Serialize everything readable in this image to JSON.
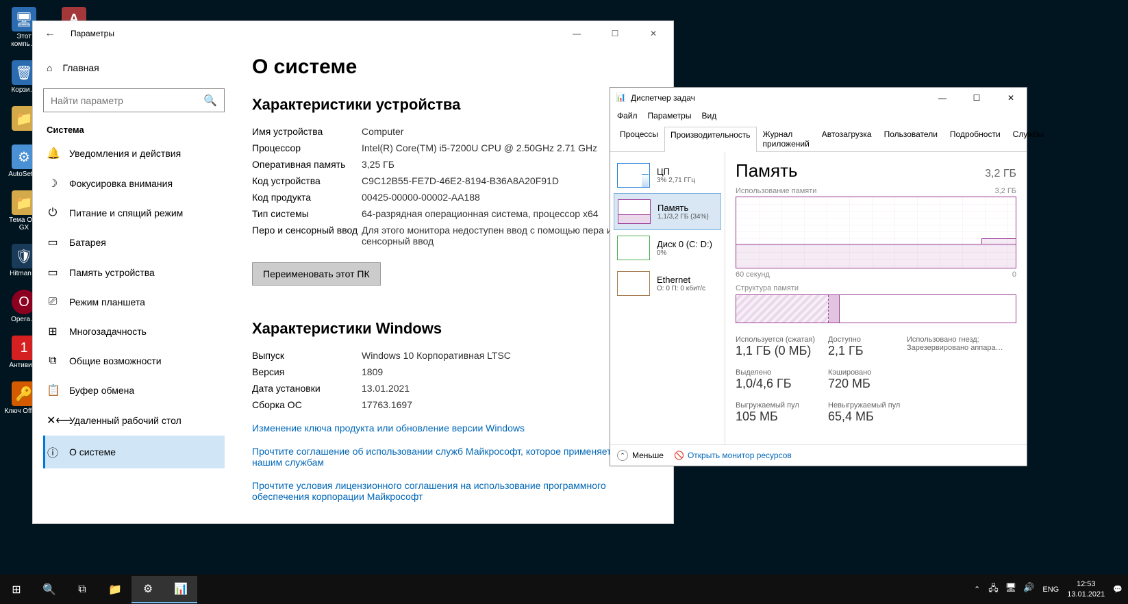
{
  "desktop": {
    "icons": [
      {
        "label": "Этот компь…",
        "color": "#2b6cb0"
      },
      {
        "label": "Корзи…",
        "color": "#2b6cb0"
      },
      {
        "label": "",
        "color": "#d4a94a"
      },
      {
        "label": "AutoSet…",
        "color": "#4a90d4"
      },
      {
        "label": "Тема О… GX",
        "color": "#d4a94a"
      },
      {
        "label": "Hitman…",
        "color": "#4a90d4"
      },
      {
        "label": "Opera…",
        "color": "#8b0020"
      },
      {
        "label": "Антиви…",
        "color": "#d42020"
      },
      {
        "label": "Ключ Offic…",
        "color": "#d45a00"
      }
    ],
    "access_icon": "Access"
  },
  "settings": {
    "title": "Параметры",
    "home": "Главная",
    "search_placeholder": "Найти параметр",
    "section": "Система",
    "nav": [
      {
        "icon": "🔔",
        "label": "Уведомления и действия"
      },
      {
        "icon": "☽",
        "label": "Фокусировка внимания"
      },
      {
        "icon": "⏻",
        "label": "Питание и спящий режим"
      },
      {
        "icon": "▭",
        "label": "Батарея"
      },
      {
        "icon": "▭",
        "label": "Память устройства"
      },
      {
        "icon": "⎚",
        "label": "Режим планшета"
      },
      {
        "icon": "⊞",
        "label": "Многозадачность"
      },
      {
        "icon": "⧉",
        "label": "Общие возможности"
      },
      {
        "icon": "📋",
        "label": "Буфер обмена"
      },
      {
        "icon": "✕⟵",
        "label": "Удаленный рабочий стол"
      },
      {
        "icon": "ⓘ",
        "label": "О системе"
      }
    ],
    "content": {
      "heading": "О системе",
      "device_heading": "Характеристики устройства",
      "specs": [
        {
          "label": "Имя устройства",
          "value": "Computer"
        },
        {
          "label": "Процессор",
          "value": "Intel(R) Core(TM) i5-7200U CPU @ 2.50GHz 2.71 GHz"
        },
        {
          "label": "Оперативная память",
          "value": "3,25 ГБ"
        },
        {
          "label": "Код устройства",
          "value": "C9C12B55-FE7D-46E2-8194-B36A8A20F91D"
        },
        {
          "label": "Код продукта",
          "value": "00425-00000-00002-AA188"
        },
        {
          "label": "Тип системы",
          "value": "64-разрядная операционная система, процессор x64"
        },
        {
          "label": "Перо и сенсорный ввод",
          "value": "Для этого монитора недоступен ввод с помощью пера и сенсорный ввод"
        }
      ],
      "rename_button": "Переименовать этот ПК",
      "windows_heading": "Характеристики Windows",
      "windows_specs": [
        {
          "label": "Выпуск",
          "value": "Windows 10 Корпоративная LTSC"
        },
        {
          "label": "Версия",
          "value": "1809"
        },
        {
          "label": "Дата установки",
          "value": "13.01.2021"
        },
        {
          "label": "Сборка ОС",
          "value": "17763.1697"
        }
      ],
      "link1": "Изменение ключа продукта или обновление версии Windows",
      "link2": "Прочтите соглашение об использовании служб Майкрософт, которое применяется к нашим службам",
      "link3": "Прочтите условия лицензионного соглашения на использование программного обеспечения корпорации Майкрософт"
    }
  },
  "taskman": {
    "title": "Диспетчер задач",
    "menu": [
      "Файл",
      "Параметры",
      "Вид"
    ],
    "tabs": [
      "Процессы",
      "Производительность",
      "Журнал приложений",
      "Автозагрузка",
      "Пользователи",
      "Подробности",
      "Службы"
    ],
    "active_tab": 1,
    "perf_items": [
      {
        "name": "ЦП",
        "stat": "3% 2,71 ГГц"
      },
      {
        "name": "Память",
        "stat": "1,1/3,2 ГБ (34%)"
      },
      {
        "name": "Диск 0 (C: D:)",
        "stat": "0%"
      },
      {
        "name": "Ethernet",
        "stat": "О: 0 П: 0 кбит/c"
      }
    ],
    "main": {
      "title": "Память",
      "total": "3,2 ГБ",
      "usage_label": "Использование памяти",
      "usage_max": "3,2 ГБ",
      "time_label": "60 секунд",
      "time_zero": "0",
      "structure_label": "Структура памяти",
      "stats": [
        {
          "label": "Используется (сжатая)",
          "value": "1,1 ГБ (0 МБ)"
        },
        {
          "label": "Доступно",
          "value": "2,1 ГБ"
        },
        {
          "label": "Использовано гнезд:",
          "value": "Зарезервировано аппара…"
        },
        {
          "label": "Выделено",
          "value": "1,0/4,6 ГБ"
        },
        {
          "label": "Кэшировано",
          "value": "720 МБ"
        },
        {
          "label": "Выгружаемый пул",
          "value": "105 МБ"
        },
        {
          "label": "Невыгружаемый пул",
          "value": "65,4 МБ"
        }
      ]
    },
    "footer": {
      "fewer": "Меньше",
      "monitor": "Открыть монитор ресурсов"
    }
  },
  "taskbar": {
    "lang": "ENG",
    "time": "12:53",
    "date": "13.01.2021"
  }
}
